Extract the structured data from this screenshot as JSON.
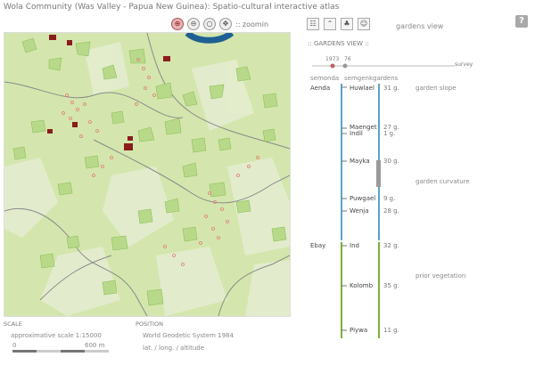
{
  "app": {
    "title": "Wola Community (Was Valley - Papua New Guinea): Spatio-cultural interactive atlas"
  },
  "map_tools": {
    "zoom_label": ":: zoomin",
    "buttons": [
      {
        "name": "zoomin-icon",
        "glyph": "⊕"
      },
      {
        "name": "zoomout-icon",
        "glyph": "⊖"
      },
      {
        "name": "reset-icon",
        "glyph": "○"
      },
      {
        "name": "pan-icon",
        "glyph": "✥"
      }
    ]
  },
  "view_tools": {
    "current_view": "gardens view",
    "icons": [
      {
        "name": "list-view-icon",
        "glyph": "☷"
      },
      {
        "name": "terrain-view-icon",
        "glyph": "⌃"
      },
      {
        "name": "gardens-view-icon",
        "glyph": "♣"
      },
      {
        "name": "people-view-icon",
        "glyph": "☺"
      }
    ],
    "help": "?"
  },
  "gardens_panel": {
    "header": ":: GARDENS VIEW ::",
    "timeline": {
      "start": "1973",
      "end": "76",
      "survey": "survey"
    },
    "columns": {
      "semonda": "semonda",
      "semgenk": "semgenk",
      "gardens": "gardens"
    },
    "communities": [
      "Aenda",
      "Ebay"
    ],
    "rows": [
      {
        "name": "Huwlael",
        "count": "31 g."
      },
      {
        "name": "Maenget",
        "count": "27 g."
      },
      {
        "name": "Indil",
        "count": "1 g."
      },
      {
        "name": "Mayka",
        "count": "30 g."
      },
      {
        "name": "Puwgael",
        "count": "9 g."
      },
      {
        "name": "Wenja",
        "count": "28 g."
      },
      {
        "name": "Ind",
        "count": "32 g."
      },
      {
        "name": "Kolomb",
        "count": "35 g."
      },
      {
        "name": "Piywa",
        "count": "11 g."
      }
    ],
    "categories": [
      "garden slope",
      "garden curvature",
      "prior vegetation"
    ]
  },
  "footer": {
    "scale_heading": "SCALE",
    "scale_text": "approximative scale 1:15000",
    "scale_zero": "0",
    "scale_end": "600 m",
    "position_heading": "POSITION",
    "position_system": "World Geodetic System 1984",
    "position_fields": "lat. / long. / altitude"
  },
  "colors": {
    "map_green": "#cfe3a5",
    "garden_polygon": "#b9d98a",
    "river": "#1f5f93",
    "house": "#8a1c1c",
    "timeline_blue": "#5aa3c7",
    "timeline_green": "#7ab03a"
  }
}
